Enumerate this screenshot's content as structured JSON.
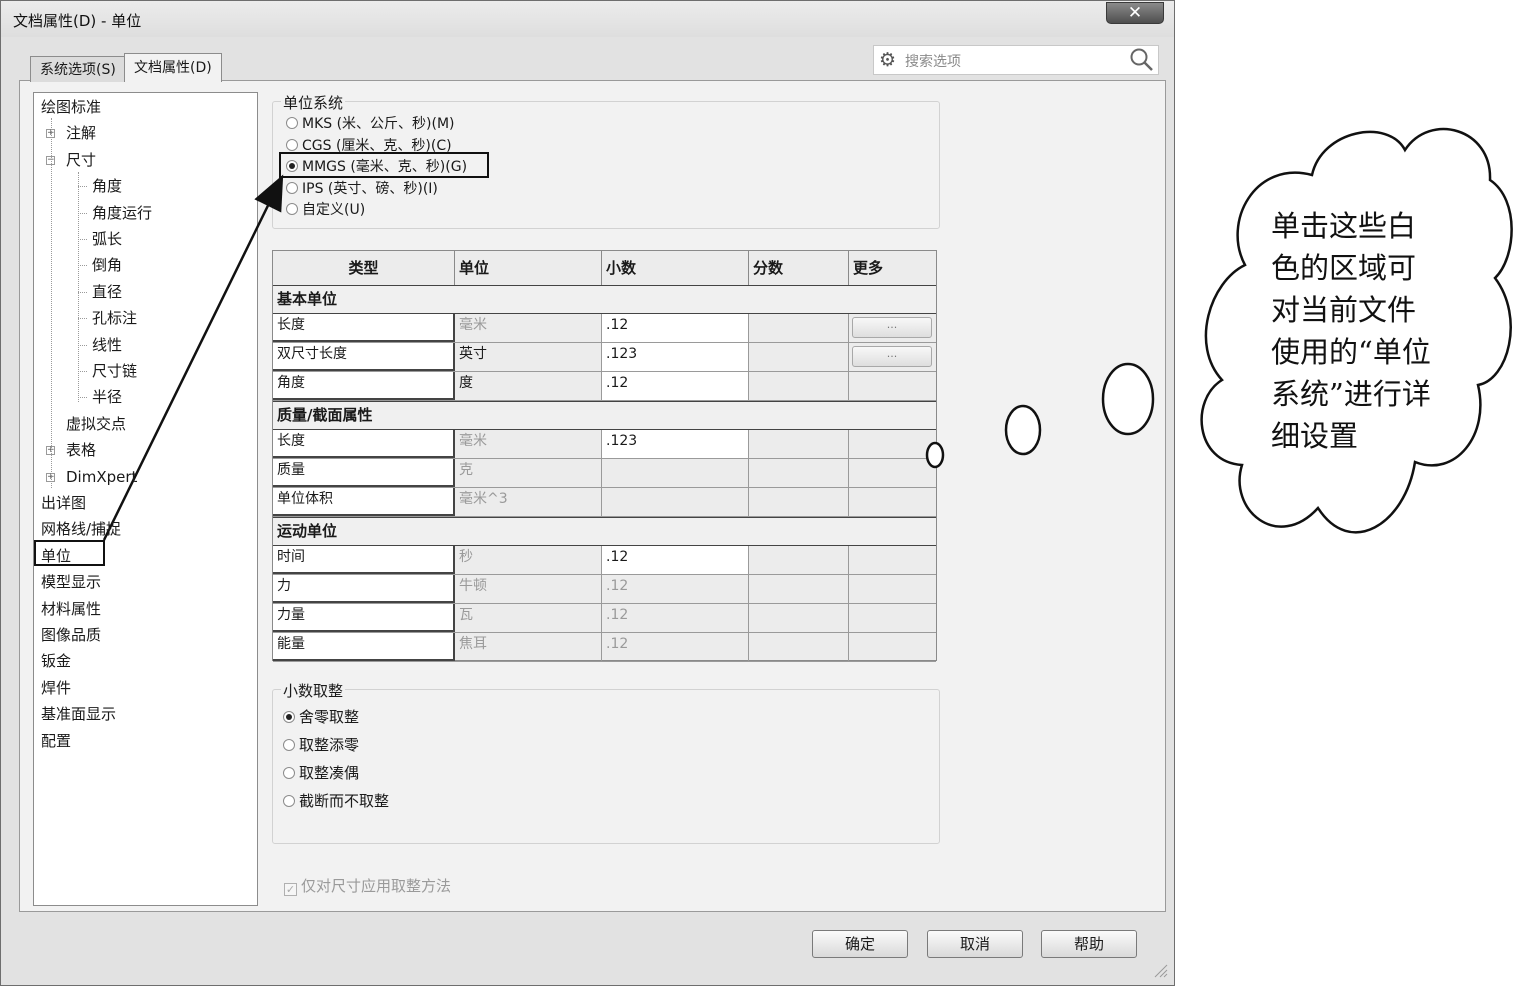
{
  "window": {
    "title": "文档属性(D) - 单位",
    "close_glyph": "✕"
  },
  "tabs": [
    {
      "label": "系统选项(S)",
      "active": false
    },
    {
      "label": "文档属性(D)",
      "active": true
    }
  ],
  "search": {
    "placeholder": "搜索选项",
    "icon_left": "gear-icon",
    "icon_right": "magnifier-icon"
  },
  "tree": {
    "items": [
      {
        "label": "绘图标准",
        "level": 0
      },
      {
        "label": "注解",
        "level": 1,
        "expander": "+"
      },
      {
        "label": "尺寸",
        "level": 1,
        "expander": "−"
      },
      {
        "label": "角度",
        "level": 2
      },
      {
        "label": "角度运行",
        "level": 2
      },
      {
        "label": "弧长",
        "level": 2
      },
      {
        "label": "倒角",
        "level": 2
      },
      {
        "label": "直径",
        "level": 2
      },
      {
        "label": "孔标注",
        "level": 2
      },
      {
        "label": "线性",
        "level": 2
      },
      {
        "label": "尺寸链",
        "level": 2
      },
      {
        "label": "半径",
        "level": 2
      },
      {
        "label": "虚拟交点",
        "level": 1
      },
      {
        "label": "表格",
        "level": 1,
        "expander": "+"
      },
      {
        "label": "DimXpert",
        "level": 1,
        "expander": "+"
      },
      {
        "label": "出详图",
        "level": 0
      },
      {
        "label": "网格线/捕捉",
        "level": 0
      },
      {
        "label": "单位",
        "level": 0,
        "selected": true
      },
      {
        "label": "模型显示",
        "level": 0
      },
      {
        "label": "材料属性",
        "level": 0
      },
      {
        "label": "图像品质",
        "level": 0
      },
      {
        "label": "钣金",
        "level": 0
      },
      {
        "label": "焊件",
        "level": 0
      },
      {
        "label": "基准面显示",
        "level": 0
      },
      {
        "label": "配置",
        "level": 0
      }
    ]
  },
  "unit_system": {
    "title": "单位系统",
    "options": [
      {
        "label": "MKS (米、公斤、秒)(M)",
        "checked": false
      },
      {
        "label": "CGS (厘米、克、秒)(C)",
        "checked": false
      },
      {
        "label": "MMGS (毫米、克、秒)(G)",
        "checked": true
      },
      {
        "label": "IPS (英寸、磅、秒)(I)",
        "checked": false
      },
      {
        "label": "自定义(U)",
        "checked": false
      }
    ]
  },
  "units_table": {
    "headers": [
      "类型",
      "单位",
      "小数",
      "分数",
      "更多"
    ],
    "sections": [
      {
        "title": "基本单位",
        "rows": [
          {
            "type": "长度",
            "unit": "毫米",
            "decimal": ".12",
            "fraction": "",
            "more": "...",
            "unit_gray": true,
            "decimal_white": true
          },
          {
            "type": "双尺寸长度",
            "unit": "英寸",
            "decimal": ".123",
            "fraction": "",
            "more": "...",
            "unit_gray": false,
            "decimal_white": true
          },
          {
            "type": "角度",
            "unit": "度",
            "decimal": ".12",
            "fraction": "",
            "more": "",
            "unit_gray": false,
            "decimal_white": true
          }
        ]
      },
      {
        "title": "质量/截面属性",
        "rows": [
          {
            "type": "长度",
            "unit": "毫米",
            "decimal": ".123",
            "fraction": "",
            "more": "",
            "unit_gray": true,
            "decimal_white": true
          },
          {
            "type": "质量",
            "unit": "克",
            "decimal": "",
            "fraction": "",
            "more": "",
            "unit_gray": true,
            "decimal_white": false
          },
          {
            "type": "单位体积",
            "unit": "毫米^3",
            "decimal": "",
            "fraction": "",
            "more": "",
            "unit_gray": true,
            "decimal_white": false
          }
        ]
      },
      {
        "title": "运动单位",
        "rows": [
          {
            "type": "时间",
            "unit": "秒",
            "decimal": ".12",
            "fraction": "",
            "more": "",
            "unit_gray": true,
            "decimal_white": true
          },
          {
            "type": "力",
            "unit": "牛顿",
            "decimal": ".12",
            "fraction": "",
            "more": "",
            "unit_gray": true,
            "decimal_white": false
          },
          {
            "type": "力量",
            "unit": "瓦",
            "decimal": ".12",
            "fraction": "",
            "more": "",
            "unit_gray": true,
            "decimal_white": false
          },
          {
            "type": "能量",
            "unit": "焦耳",
            "decimal": ".12",
            "fraction": "",
            "more": "",
            "unit_gray": true,
            "decimal_white": false
          }
        ]
      }
    ]
  },
  "rounding": {
    "title": "小数取整",
    "options": [
      {
        "label": "舍零取整",
        "checked": true
      },
      {
        "label": "取整添零",
        "checked": false
      },
      {
        "label": "取整凑偶",
        "checked": false
      },
      {
        "label": "截断而不取整",
        "checked": false
      }
    ]
  },
  "apply_rounding_checkbox": {
    "label": "仅对尺寸应用取整方法",
    "checked": true,
    "disabled": true
  },
  "buttons": {
    "ok": "确定",
    "cancel": "取消",
    "help": "帮助"
  },
  "callout": {
    "text": "单击这些白色的区域可对当前文件使用的“单位系统”进行详细设置"
  }
}
